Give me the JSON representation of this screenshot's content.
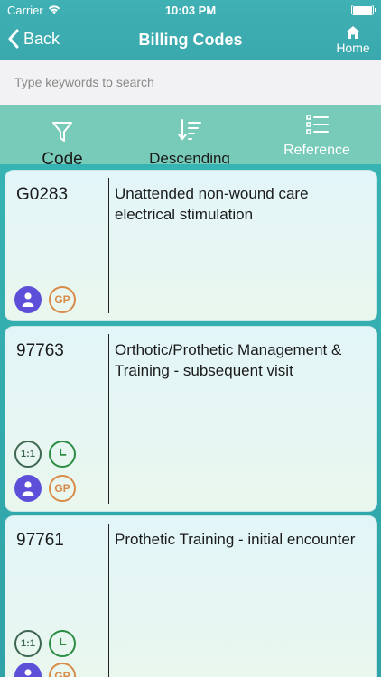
{
  "status": {
    "carrier": "Carrier",
    "time": "10:03 PM"
  },
  "nav": {
    "back_label": "Back",
    "title": "Billing Codes",
    "home_label": "Home"
  },
  "search": {
    "placeholder": "Type keywords to search",
    "value": ""
  },
  "toolbar": {
    "code_label": "Code",
    "descending_label": "Descending",
    "reference_label": "Reference"
  },
  "items": [
    {
      "code": "G0283",
      "description": "Unattended non-wound care electrical stimulation",
      "badges": [
        "person-icon",
        "gp-icon"
      ]
    },
    {
      "code": "97763",
      "description": "Orthotic/Prothetic Management & Training - subsequent visit",
      "badges": [
        "one-to-one-icon",
        "clock-icon",
        "person-icon",
        "gp-icon"
      ]
    },
    {
      "code": "97761",
      "description": "Prothetic Training - initial encounter",
      "badges": [
        "one-to-one-icon",
        "clock-icon",
        "person-icon",
        "gp-icon"
      ]
    }
  ],
  "badge_text": {
    "gp": "GP",
    "one_to_one": "1:1"
  },
  "colors": {
    "header": "#3fb0b4",
    "toolbar": "#78cbb8",
    "person": "#5d4fd8",
    "gp": "#d98b49",
    "clock": "#2b8d43",
    "one_to_one": "#3d6650"
  }
}
